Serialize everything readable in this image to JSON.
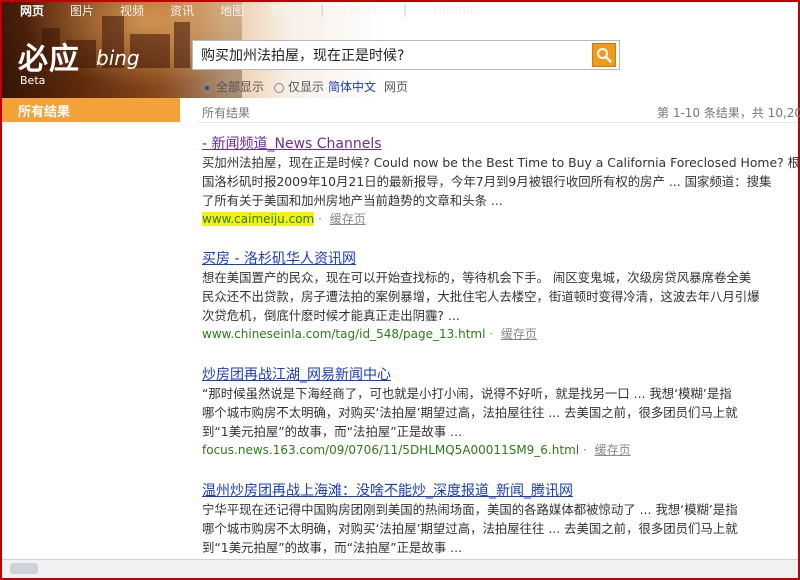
{
  "topnav": {
    "items": [
      "网页",
      "图片",
      "视频",
      "资讯",
      "地图",
      "更多"
    ],
    "msn": "MSN",
    "hotmail": "Hotmail"
  },
  "logo": {
    "cn": "必应",
    "en": "bing",
    "beta": "Beta"
  },
  "search": {
    "query": "购买加州法拍屋，现在正是时候?"
  },
  "scope": {
    "all": "全部显示",
    "only": "仅显示",
    "lang": "简体中文",
    "suffix": "网页"
  },
  "sidebar": {
    "all_results": "所有结果"
  },
  "results_header": {
    "label": "所有结果",
    "count": "第 1-10 条结果，共 10,20"
  },
  "results": [
    {
      "title": "- 新闻频道_News Channels",
      "snippet": [
        "买加州法拍屋，现在正是时候? Could now be the Best Time to Buy a California Foreclosed Home? 根据",
        "国洛杉矶时报2009年10月21日的最新报导，今年7月到9月被银行收回所有权的房产 ... 国家频道：搜集",
        "了所有关于美国和加州房地产当前趋势的文章和头条 ..."
      ],
      "url": "www.caimeiju.com",
      "cache": "缓存页"
    },
    {
      "title": "买房 - 洛杉矶华人资讯网",
      "snippet": [
        "想在美国置产的民众，现在可以开始查找标的，等待机会下手。 闹区变鬼城，次级房贷风暴席卷全美",
        "民众还不出贷款，房子遭法拍的案例暴增，大批住宅人去楼空，街道顿时变得冷清，这波去年八月引爆",
        "次贷危机，倒底什麽时候才能真正走出阴霾? ..."
      ],
      "url": "www.chineseinla.com/tag/id_548/page_13.html",
      "cache": "缓存页"
    },
    {
      "title": "炒房团再战江湖_网易新闻中心",
      "snippet": [
        "“那时候虽然说是下海经商了，可也就是小打小闹，说得不好听，就是找另一口 ... 我想‘模糊’是指",
        "哪个城市购房不太明确，对购买‘法拍屋’期望过高，法拍屋往往 ... 去美国之前，很多团员们马上就",
        "到“1美元拍屋”的故事，而“法拍屋”正是故事 ..."
      ],
      "url": "focus.news.163.com/09/0706/11/5DHLMQ5A00011SM9_6.html",
      "cache": "缓存页"
    },
    {
      "title": "温州炒房团再战上海滩：没啥不能炒_深度报道_新闻_腾讯网",
      "snippet": [
        "宁华平现在还记得中国购房团刚到美国的热闹场面，美国的各路媒体都被惊动了 ... 我想‘模糊’是指",
        "哪个城市购房不太明确，对购买‘法拍屋’期望过高，法拍屋往往 ... 去美国之前，很多团员们马上就",
        "到“1美元拍屋”的故事，而“法拍屋”正是故事 ..."
      ]
    }
  ]
}
